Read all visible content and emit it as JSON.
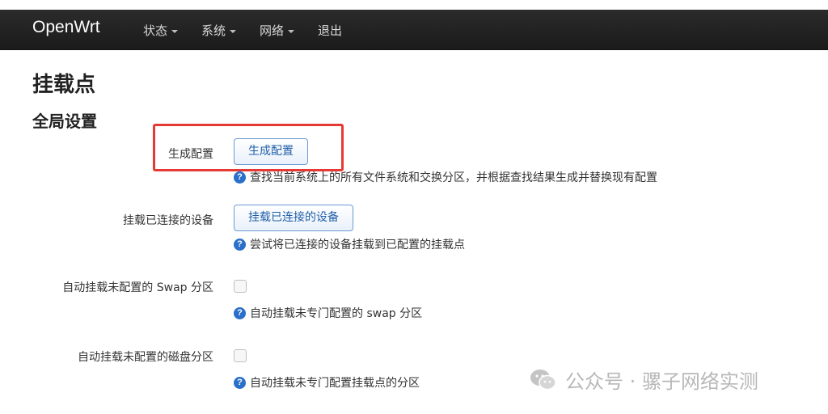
{
  "navbar": {
    "brand": "OpenWrt",
    "items": [
      {
        "label": "状态",
        "has_dropdown": true
      },
      {
        "label": "系统",
        "has_dropdown": true
      },
      {
        "label": "网络",
        "has_dropdown": true
      },
      {
        "label": "退出",
        "has_dropdown": false
      }
    ]
  },
  "page": {
    "title": "挂载点",
    "section_title": "全局设置"
  },
  "settings": {
    "generate_config": {
      "label": "生成配置",
      "button": "生成配置",
      "help": "查找当前系统上的所有文件系统和交换分区，并根据查找结果生成并替换现有配置"
    },
    "mount_attached": {
      "label": "挂载已连接的设备",
      "button": "挂载已连接的设备",
      "help": "尝试将已连接的设备挂载到已配置的挂载点"
    },
    "auto_swap": {
      "label": "自动挂载未配置的 Swap 分区",
      "checked": false,
      "help": "自动挂载未专门配置的 swap 分区"
    },
    "auto_mount": {
      "label": "自动挂载未配置的磁盘分区",
      "checked": false,
      "help": "自动挂载未专门配置挂载点的分区"
    }
  },
  "colors": {
    "navbar_bg": "#222222",
    "highlight": "#e53935",
    "button_text": "#1f5fa8",
    "help_icon": "#2a6fc9"
  },
  "watermark": {
    "icon": "wechat-icon",
    "text": "公众号 · 骡子网络实测"
  }
}
